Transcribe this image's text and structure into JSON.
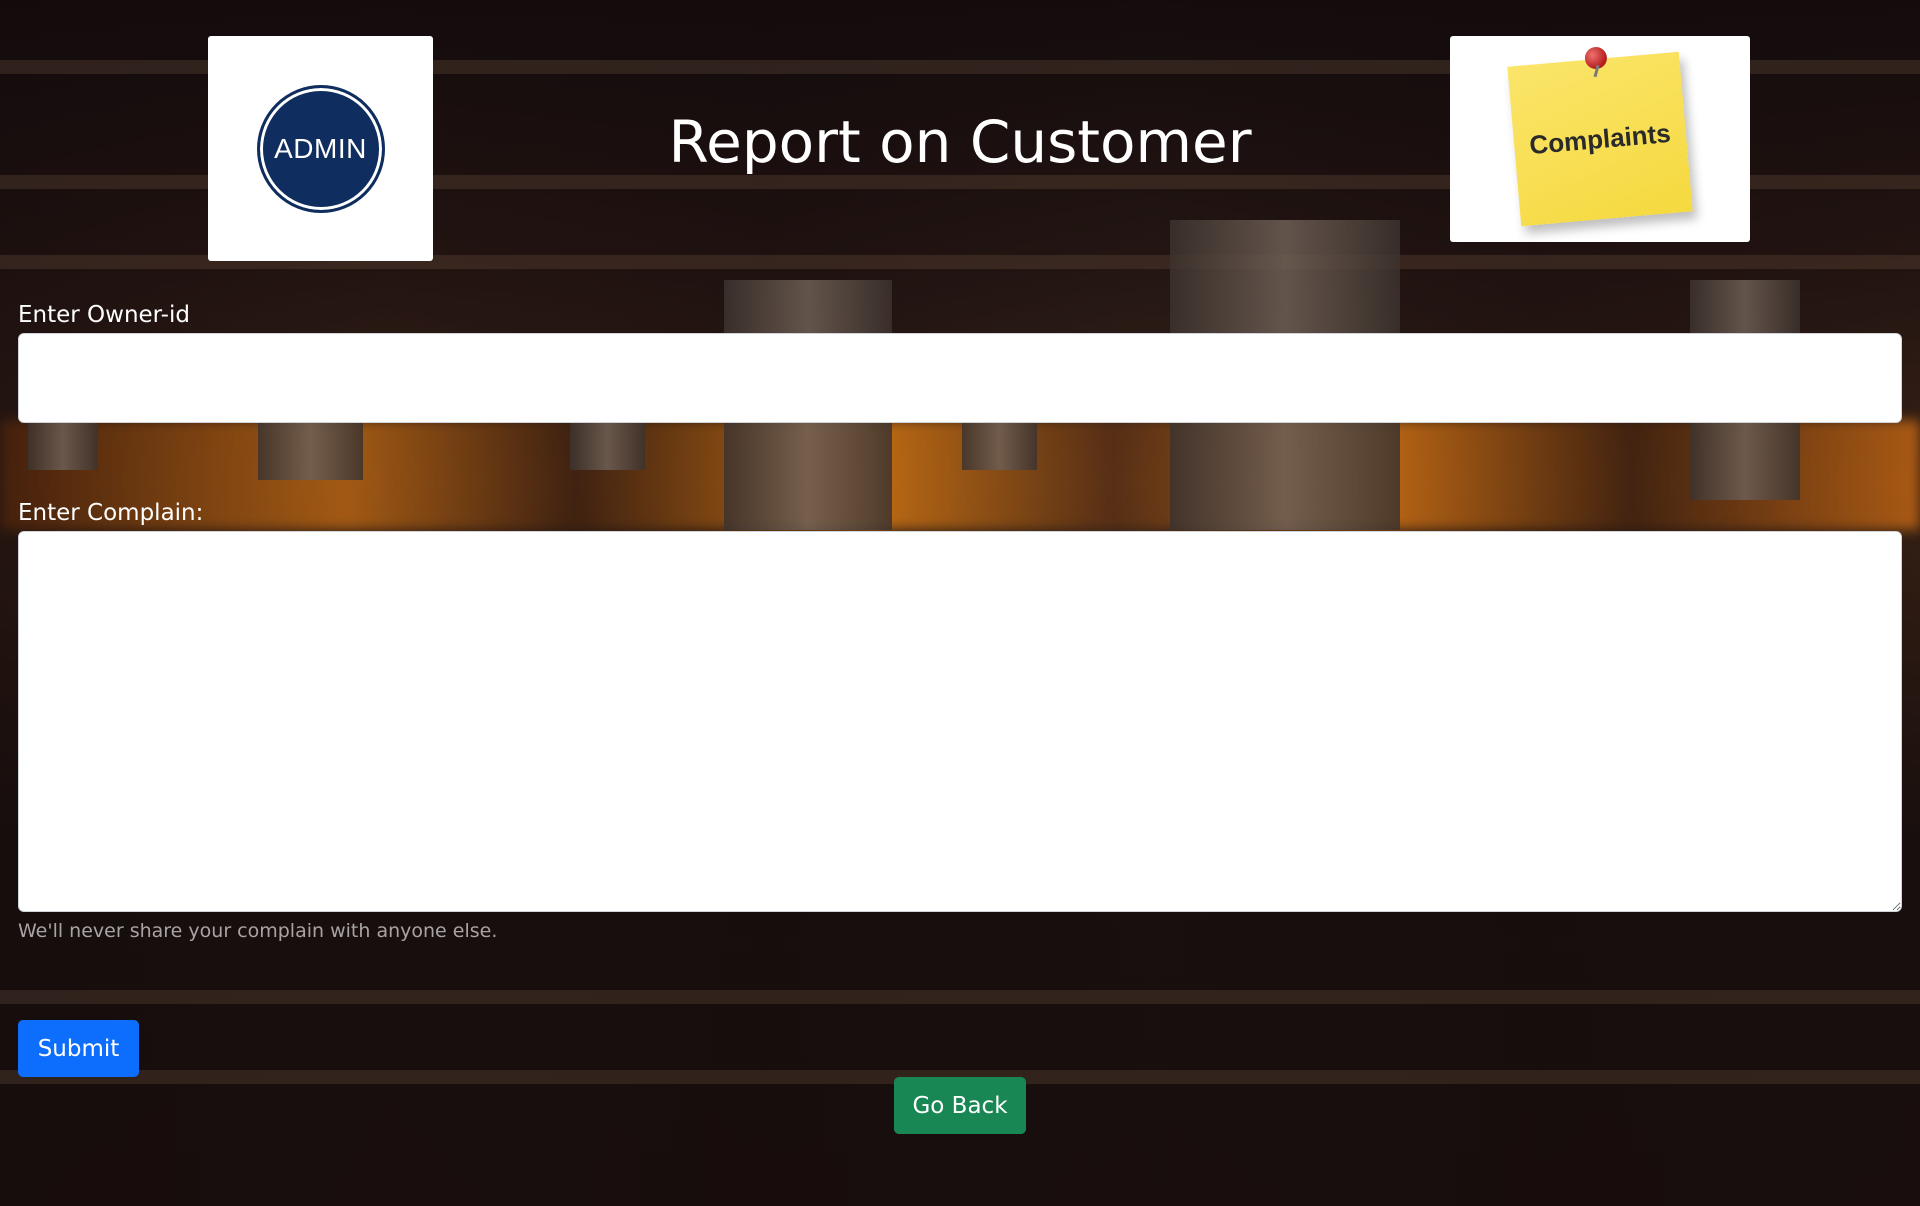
{
  "page": {
    "title": "Report on Customer"
  },
  "logos": {
    "admin_text": "ADMIN",
    "complaints_text": "Complaints"
  },
  "form": {
    "owner_label": "Enter Owner-id",
    "owner_value": "",
    "complain_label": "Enter Complain:",
    "complain_value": "",
    "help_text": "We'll never share your complain with anyone else."
  },
  "buttons": {
    "submit_label": "Submit",
    "go_back_label": "Go Back"
  },
  "colors": {
    "submit": "#0d6efd",
    "go_back": "#198754",
    "admin_badge": "#0f2d5e",
    "sticky_note": "#f5d93f"
  },
  "icons": {
    "admin_logo": "admin-badge-icon",
    "complaints_logo": "sticky-note-icon",
    "pin": "push-pin-icon"
  }
}
